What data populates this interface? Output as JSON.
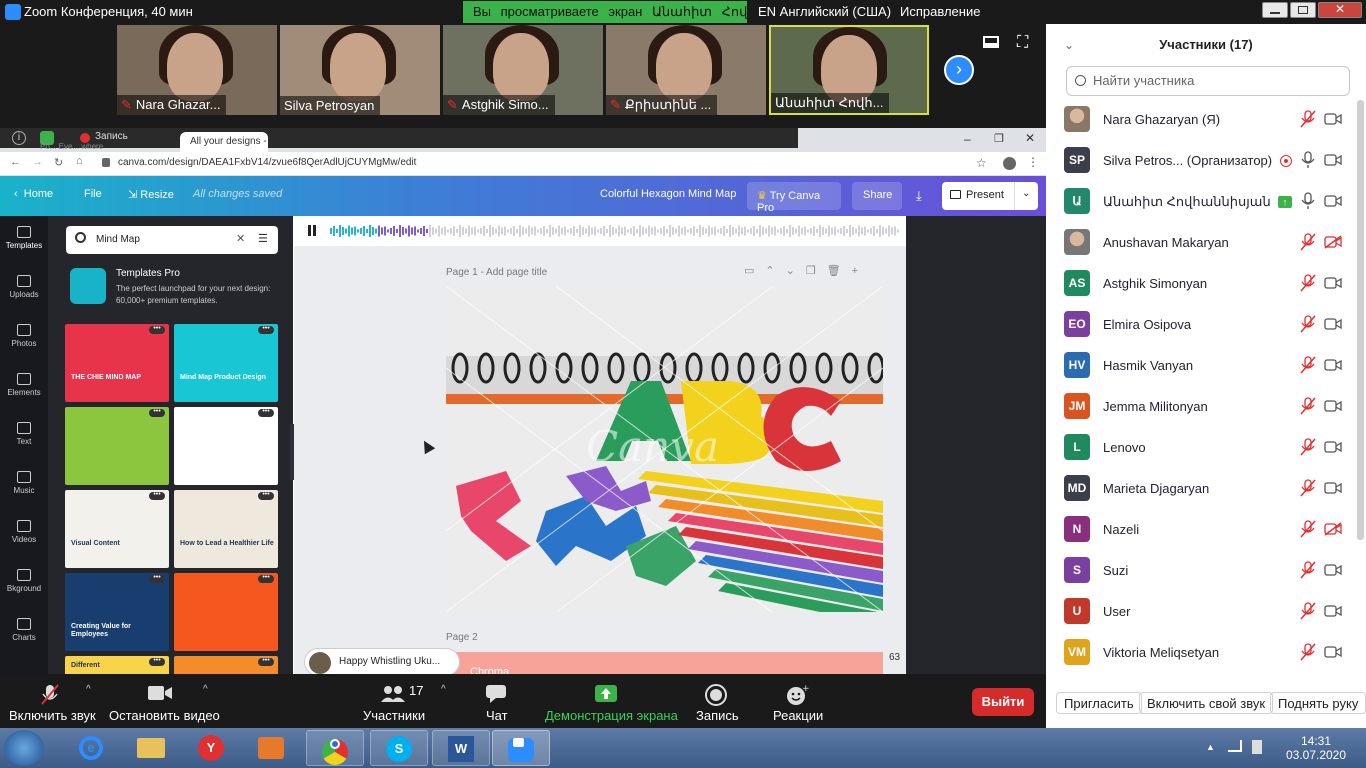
{
  "window": {
    "title": "Zoom Конференция, 40 мин"
  },
  "share_banner": "Вы  просматриваете  экран Անահիտ Հովհաննիսյան",
  "lang_indicator": "EN Английский (США)",
  "fix_label": "Исправление",
  "thumbnails": [
    {
      "name": "Nara Ghazar...",
      "muted": true
    },
    {
      "name": "Silva Petrosyan",
      "muted": false
    },
    {
      "name": "Astghik Simo...",
      "muted": true
    },
    {
      "name": "Քրիստինե ...",
      "muted": true
    },
    {
      "name": "Անահիտ Հովհ...",
      "muted": false
    }
  ],
  "browser": {
    "record_label": "Запись",
    "tabs": [
      "Po... Eve... where",
      "All your designs - Ca"
    ],
    "url": "canva.com/design/DAEA1FxbV14/zvue6f8QerAdlUjCUYMgMw/edit"
  },
  "canva": {
    "home": "Home",
    "file": "File",
    "resize": "Resize",
    "saved": "All changes saved",
    "doc_title": "Colorful Hexagon Mind Map",
    "try_pro": "Try Canva Pro",
    "share": "Share",
    "present": "Present",
    "rail": [
      "Templates",
      "Uploads",
      "Photos",
      "Elements",
      "Text",
      "Music",
      "Videos",
      "Bkground",
      "Charts"
    ],
    "search_value": "Mind Map",
    "templates_pro_title": "Templates Pro",
    "templates_pro_sub": "The perfect launchpad for your next design: 60,000+ premium templates.",
    "templates": [
      {
        "bg": "#e8344a",
        "text": "THE CHIE MIND MAP"
      },
      {
        "bg": "#19c6d4",
        "text": "Mind Map Product Design"
      },
      {
        "bg": "#8cc63e",
        "text": ""
      },
      {
        "bg": "#ffffff",
        "text": ""
      },
      {
        "bg": "#f3f1ec",
        "text": "Visual Content"
      },
      {
        "bg": "#efe8dc",
        "text": "How to Lead a Healthier Life"
      },
      {
        "bg": "#173e6e",
        "text": "Creating Value for Employees"
      },
      {
        "bg": "#f5571e",
        "text": ""
      },
      {
        "bg": "#f7d44a",
        "text": "Different"
      },
      {
        "bg": "#f58c2a",
        "text": ""
      }
    ],
    "page1_label": "Page 1 - Add page title",
    "page2_label": "Page 2",
    "page2_title": "Chroma...",
    "music_track": "Happy Whistling Uku...",
    "zoom_pct": "63",
    "watermark": "Canva"
  },
  "toolbar": {
    "mute": "Включить звук",
    "video": "Остановить видео",
    "participants": "Участники",
    "participants_count": "17",
    "chat": "Чат",
    "share_screen": "Демонстрация экрана",
    "record": "Запись",
    "reactions": "Реакции",
    "leave": "Выйти"
  },
  "participants_panel": {
    "title": "Участники (17)",
    "search_placeholder": "Найти участника",
    "invite": "Пригласить",
    "unmute_self": "Включить свой звук",
    "raise_hand": "Поднять руку"
  },
  "participants": [
    {
      "initials": "",
      "name": "Nara Ghazaryan (Я)",
      "color": "#8a7766",
      "mic": "muted",
      "cam": "on",
      "photo": true
    },
    {
      "initials": "SP",
      "name": "Silva Petros...  (Организатор)",
      "color": "#3b3f4a",
      "mic": "on",
      "cam": "on",
      "recording": true
    },
    {
      "initials": "Ա",
      "name": "Անահիտ Հովհաննիսյան",
      "color": "#23876b",
      "mic": "on",
      "cam": "on",
      "sharing": true
    },
    {
      "initials": "",
      "name": "Anushavan Makaryan",
      "color": "#777777",
      "mic": "muted",
      "cam": "off",
      "photo": true
    },
    {
      "initials": "AS",
      "name": "Astghik Simonyan",
      "color": "#1f8a5e",
      "mic": "muted",
      "cam": "on"
    },
    {
      "initials": "EO",
      "name": "Elmira Osipova",
      "color": "#7b3fa0",
      "mic": "muted",
      "cam": "on"
    },
    {
      "initials": "HV",
      "name": "Hasmik Vanyan",
      "color": "#2b6cb0",
      "mic": "muted",
      "cam": "on"
    },
    {
      "initials": "JM",
      "name": "Jemma Militonyan",
      "color": "#d9541e",
      "mic": "muted",
      "cam": "on"
    },
    {
      "initials": "L",
      "name": "Lenovo",
      "color": "#1f8a5e",
      "mic": "muted",
      "cam": "on"
    },
    {
      "initials": "MD",
      "name": "Marieta Djagaryan",
      "color": "#3b3f4a",
      "mic": "muted",
      "cam": "on"
    },
    {
      "initials": "N",
      "name": "Nazeli",
      "color": "#8a2e7e",
      "mic": "muted",
      "cam": "off"
    },
    {
      "initials": "S",
      "name": "Suzi",
      "color": "#7b3fa0",
      "mic": "muted",
      "cam": "on"
    },
    {
      "initials": "U",
      "name": "User",
      "color": "#c0392b",
      "mic": "muted",
      "cam": "on"
    },
    {
      "initials": "VM",
      "name": "Viktoria Meliqsetyan",
      "color": "#e0a31c",
      "mic": "muted",
      "cam": "on"
    }
  ],
  "taskbar": {
    "time": "14:31",
    "date": "03.07.2020"
  },
  "colors": {
    "zoom_blue": "#2d8cff",
    "share_green": "#3bb34a",
    "leave_red": "#d62b2b",
    "mute_red": "#e03030"
  }
}
